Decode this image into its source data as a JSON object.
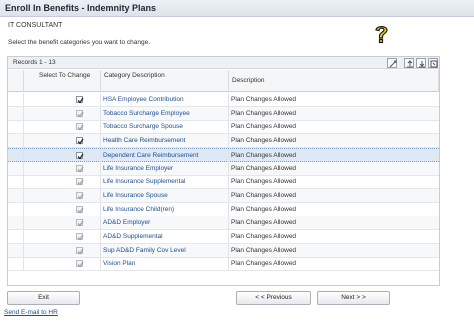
{
  "header": {
    "title": "Enroll In Benefits - Indemnity Plans"
  },
  "role": "IT CONSULTANT",
  "instructions": "Select the benefit categories you want to change.",
  "grid": {
    "records_label": "Records 1 - 13",
    "columns": {
      "select": "Select To Change",
      "category": "Category Description",
      "description": "Description"
    },
    "rows": [
      {
        "category": "HSA Employee Contribution",
        "description": "Plan Changes Allowed",
        "checked": true,
        "enabled": true
      },
      {
        "category": "Tobacco Surcharge Employee",
        "description": "Plan Changes Allowed",
        "checked": true,
        "enabled": false
      },
      {
        "category": "Tobacco Surcharge Spouse",
        "description": "Plan Changes Allowed",
        "checked": true,
        "enabled": false
      },
      {
        "category": "Health Care Reimbursement",
        "description": "Plan Changes Allowed",
        "checked": true,
        "enabled": true
      },
      {
        "category": "Dependent Care Reimbursement",
        "description": "Plan Changes Allowed",
        "checked": true,
        "enabled": true
      },
      {
        "category": "Life Insurance Employer",
        "description": "Plan Changes Allowed",
        "checked": true,
        "enabled": false
      },
      {
        "category": "Life Insurance Supplemental",
        "description": "Plan Changes Allowed",
        "checked": true,
        "enabled": false
      },
      {
        "category": "Life Insurance Spouse",
        "description": "Plan Changes Allowed",
        "checked": true,
        "enabled": false
      },
      {
        "category": "Life Insurance Child(ren)",
        "description": "Plan Changes Allowed",
        "checked": true,
        "enabled": false
      },
      {
        "category": "AD&D Employer",
        "description": "Plan Changes Allowed",
        "checked": true,
        "enabled": false
      },
      {
        "category": "AD&D Supplemental",
        "description": "Plan Changes Allowed",
        "checked": true,
        "enabled": false
      },
      {
        "category": "Sup AD&D Family Cov Level",
        "description": "Plan Changes Allowed",
        "checked": true,
        "enabled": false
      },
      {
        "category": "Vision Plan",
        "description": "Plan Changes Allowed",
        "checked": true,
        "enabled": false
      }
    ]
  },
  "buttons": {
    "exit": "Exit",
    "previous": "< < Previous",
    "next": "Next > >"
  },
  "links": {
    "email": "Send E-mail to HR"
  },
  "colors": {
    "link": "#1f4e93",
    "highlight_row": "#dfe9f6",
    "help_icon": "#f2d600"
  },
  "icons": [
    "help-icon",
    "personalize-icon",
    "export-icon",
    "download-icon",
    "zoom-icon"
  ]
}
